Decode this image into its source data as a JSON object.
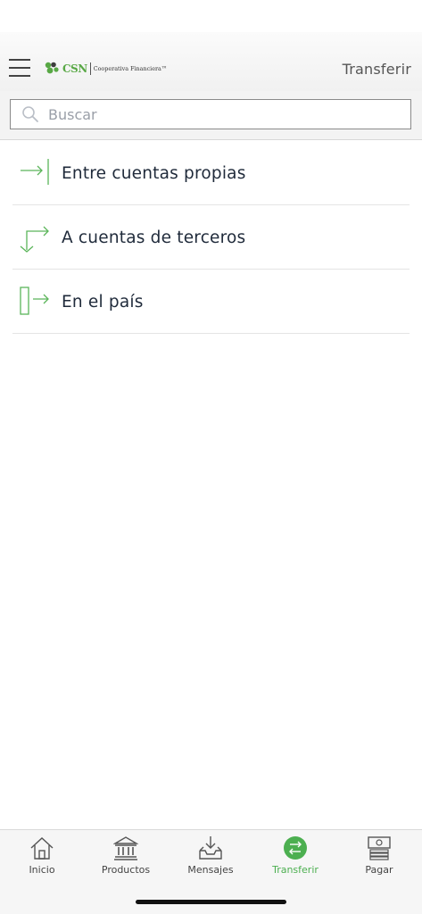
{
  "header": {
    "title": "Transferir",
    "logo": {
      "brand": "CSN",
      "tagline": "Cooperativa Financiera™"
    }
  },
  "search": {
    "placeholder": "Buscar",
    "value": ""
  },
  "menu": {
    "items": [
      {
        "label": "Entre cuentas propias",
        "icon": "arrow-to-line-icon"
      },
      {
        "label": "A cuentas de terceros",
        "icon": "corner-arrows-icon"
      },
      {
        "label": "En el país",
        "icon": "box-arrow-icon"
      }
    ]
  },
  "bottom_nav": {
    "items": [
      {
        "label": "Inicio",
        "icon": "home-icon"
      },
      {
        "label": "Productos",
        "icon": "bank-icon"
      },
      {
        "label": "Mensajes",
        "icon": "inbox-download-icon"
      },
      {
        "label": "Transferir",
        "icon": "transfer-icon",
        "active": true
      },
      {
        "label": "Pagar",
        "icon": "cash-register-icon"
      }
    ]
  },
  "colors": {
    "accent": "#4caf50",
    "icon_green": "#5bb55a",
    "text_dark": "#1f2a3a",
    "header_bg": "#f3f3f3"
  }
}
